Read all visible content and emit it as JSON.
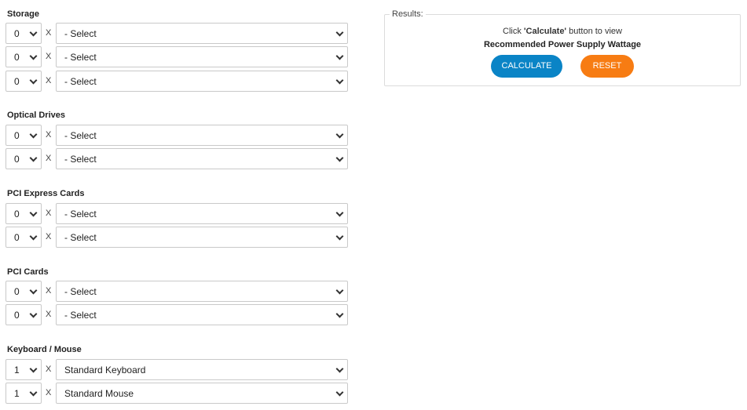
{
  "sections": [
    {
      "key": "storage",
      "title": "Storage",
      "rows": [
        {
          "qty": "0",
          "part": "- Select"
        },
        {
          "qty": "0",
          "part": "- Select"
        },
        {
          "qty": "0",
          "part": "- Select"
        }
      ]
    },
    {
      "key": "optical",
      "title": "Optical Drives",
      "rows": [
        {
          "qty": "0",
          "part": "- Select"
        },
        {
          "qty": "0",
          "part": "- Select"
        }
      ]
    },
    {
      "key": "pcie",
      "title": "PCI Express Cards",
      "rows": [
        {
          "qty": "0",
          "part": "- Select"
        },
        {
          "qty": "0",
          "part": "- Select"
        }
      ]
    },
    {
      "key": "pci",
      "title": "PCI Cards",
      "rows": [
        {
          "qty": "0",
          "part": "- Select"
        },
        {
          "qty": "0",
          "part": "- Select"
        }
      ]
    },
    {
      "key": "keyboard-mouse",
      "title": "Keyboard / Mouse",
      "rows": [
        {
          "qty": "1",
          "part": "Standard Keyboard"
        },
        {
          "qty": "1",
          "part": "Standard Mouse"
        }
      ]
    }
  ],
  "multiplier_symbol": "X",
  "results": {
    "legend": "Results:",
    "message_prefix": "Click ",
    "message_emphasis": "'Calculate'",
    "message_suffix": " button to view",
    "message_line2": "Recommended Power Supply Wattage",
    "calculate_label": "CALCULATE",
    "reset_label": "RESET"
  },
  "colors": {
    "calculate_button": "#0a84c6",
    "reset_button": "#f77c13"
  },
  "icons": {
    "dropdown": "chevron-down-icon"
  }
}
